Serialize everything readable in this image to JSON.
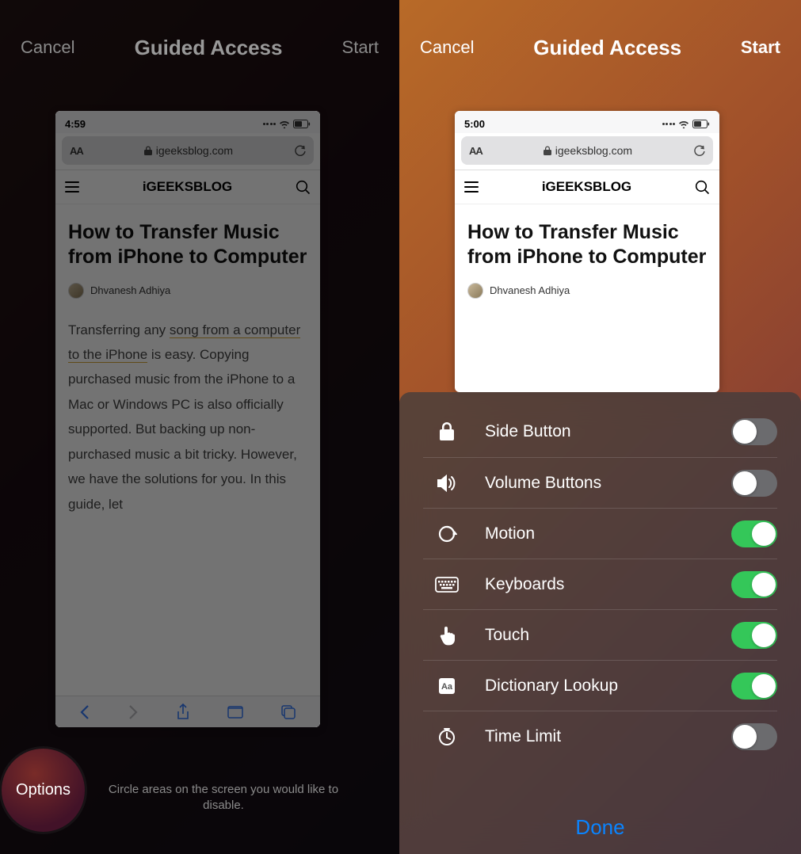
{
  "left": {
    "header": {
      "cancel": "Cancel",
      "title": "Guided Access",
      "start": "Start"
    },
    "statusbar_time": "4:59",
    "url": {
      "aa": "AA",
      "domain": "igeeksblog.com"
    },
    "site_logo": "iGEEKSBLOG",
    "article": {
      "title": "How to Transfer Music from iPhone to Computer",
      "author": "Dhvanesh Adhiya",
      "body_pre": "Transferring any ",
      "body_link": "song from a computer to the iPhone",
      "body_post": " is easy. Copying purchased music from the iPhone to a Mac or Windows PC is also officially supported. But backing up non-purchased music a bit tricky. However, we have the solutions for you. In this guide, let"
    },
    "options": "Options",
    "hint": "Circle areas on the screen you would like to disable."
  },
  "right": {
    "header": {
      "cancel": "Cancel",
      "title": "Guided Access",
      "start": "Start"
    },
    "statusbar_time": "5:00",
    "url": {
      "aa": "AA",
      "domain": "igeeksblog.com"
    },
    "site_logo": "iGEEKSBLOG",
    "article": {
      "title": "How to Transfer Music from iPhone to Computer",
      "author": "Dhvanesh Adhiya"
    },
    "options_panel": {
      "items": [
        {
          "icon": "lock",
          "label": "Side Button",
          "on": false
        },
        {
          "icon": "volume",
          "label": "Volume Buttons",
          "on": false
        },
        {
          "icon": "rotate",
          "label": "Motion",
          "on": true
        },
        {
          "icon": "keyboard",
          "label": "Keyboards",
          "on": true
        },
        {
          "icon": "touch",
          "label": "Touch",
          "on": true
        },
        {
          "icon": "dictionary",
          "label": "Dictionary Lookup",
          "on": true
        },
        {
          "icon": "timer",
          "label": "Time Limit",
          "on": false
        }
      ],
      "done": "Done"
    }
  }
}
